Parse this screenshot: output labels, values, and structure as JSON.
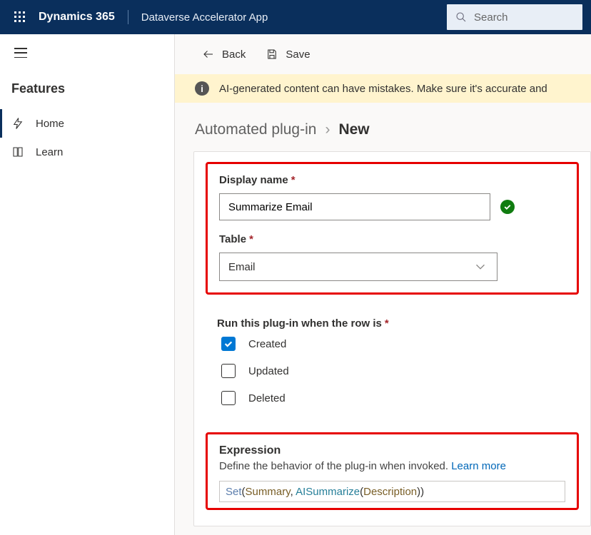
{
  "header": {
    "brand": "Dynamics 365",
    "app_name": "Dataverse Accelerator App",
    "search_placeholder": "Search"
  },
  "sidebar": {
    "group_label": "Features",
    "items": [
      {
        "label": "Home",
        "icon": "lightning-icon",
        "active": true
      },
      {
        "label": "Learn",
        "icon": "book-icon",
        "active": false
      }
    ]
  },
  "toolbar": {
    "back_label": "Back",
    "save_label": "Save"
  },
  "warning": "AI-generated content can have mistakes. Make sure it's accurate and",
  "breadcrumb": {
    "seg1": "Automated plug-in",
    "seg2": "New"
  },
  "form": {
    "display_name_label": "Display name",
    "display_name_value": "Summarize Email",
    "table_label": "Table",
    "table_value": "Email",
    "trigger_label": "Run this plug-in when the row is",
    "options": [
      {
        "label": "Created",
        "checked": true
      },
      {
        "label": "Updated",
        "checked": false
      },
      {
        "label": "Deleted",
        "checked": false
      }
    ],
    "expression_title": "Expression",
    "expression_desc": "Define the behavior of the plug-in when invoked.",
    "learn_more": "Learn more",
    "expr_tokens": {
      "t1": "Set",
      "t2": "(",
      "t3": "Summary",
      "t4": ", ",
      "t5": "AISummarize",
      "t6": "(",
      "t7": "Description",
      "t8": "))"
    }
  }
}
